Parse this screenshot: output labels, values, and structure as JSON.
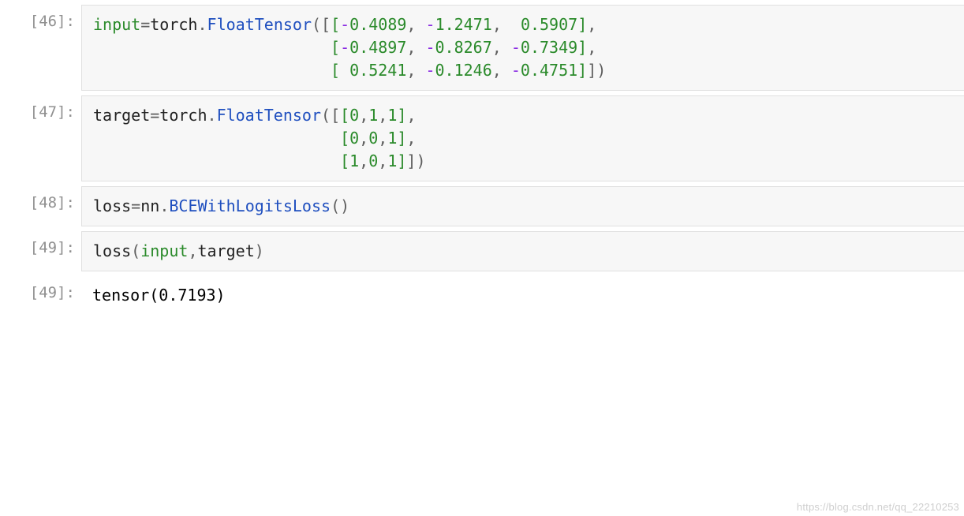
{
  "cells": [
    {
      "prompt": "[46]:",
      "kind": "code",
      "tokens": [
        [
          "builtin",
          "input"
        ],
        [
          "op",
          "="
        ],
        [
          "name",
          "torch"
        ],
        [
          "op",
          "."
        ],
        [
          "class",
          "FloatTensor"
        ],
        [
          "op",
          "("
        ],
        [
          "op",
          "["
        ],
        [
          "bracket2",
          "["
        ],
        [
          "sign",
          "-"
        ],
        [
          "num",
          "0.4089"
        ],
        [
          "op",
          ", "
        ],
        [
          "sign",
          "-"
        ],
        [
          "num",
          "1.2471"
        ],
        [
          "op",
          ",  "
        ],
        [
          "num",
          "0.5907"
        ],
        [
          "bracket2",
          "]"
        ],
        [
          "op",
          ","
        ],
        [
          "nl",
          "\n"
        ],
        [
          "sp",
          "                         "
        ],
        [
          "bracket2",
          "["
        ],
        [
          "sign",
          "-"
        ],
        [
          "num",
          "0.4897"
        ],
        [
          "op",
          ", "
        ],
        [
          "sign",
          "-"
        ],
        [
          "num",
          "0.8267"
        ],
        [
          "op",
          ", "
        ],
        [
          "sign",
          "-"
        ],
        [
          "num",
          "0.7349"
        ],
        [
          "bracket2",
          "]"
        ],
        [
          "op",
          ","
        ],
        [
          "nl",
          "\n"
        ],
        [
          "sp",
          "                         "
        ],
        [
          "bracket2",
          "[ "
        ],
        [
          "num",
          "0.5241"
        ],
        [
          "op",
          ", "
        ],
        [
          "sign",
          "-"
        ],
        [
          "num",
          "0.1246"
        ],
        [
          "op",
          ", "
        ],
        [
          "sign",
          "-"
        ],
        [
          "num",
          "0.4751"
        ],
        [
          "bracket2",
          "]"
        ],
        [
          "op",
          "]"
        ],
        [
          "op",
          ")"
        ]
      ]
    },
    {
      "prompt": "[47]:",
      "kind": "code",
      "tokens": [
        [
          "name",
          "target"
        ],
        [
          "op",
          "="
        ],
        [
          "name",
          "torch"
        ],
        [
          "op",
          "."
        ],
        [
          "class",
          "FloatTensor"
        ],
        [
          "op",
          "("
        ],
        [
          "op",
          "["
        ],
        [
          "bracket2",
          "["
        ],
        [
          "num",
          "0"
        ],
        [
          "op",
          ","
        ],
        [
          "num",
          "1"
        ],
        [
          "op",
          ","
        ],
        [
          "num",
          "1"
        ],
        [
          "bracket2",
          "]"
        ],
        [
          "op",
          ","
        ],
        [
          "nl",
          "\n"
        ],
        [
          "sp",
          "                          "
        ],
        [
          "bracket2",
          "["
        ],
        [
          "num",
          "0"
        ],
        [
          "op",
          ","
        ],
        [
          "num",
          "0"
        ],
        [
          "op",
          ","
        ],
        [
          "num",
          "1"
        ],
        [
          "bracket2",
          "]"
        ],
        [
          "op",
          ","
        ],
        [
          "nl",
          "\n"
        ],
        [
          "sp",
          "                          "
        ],
        [
          "bracket2",
          "["
        ],
        [
          "num",
          "1"
        ],
        [
          "op",
          ","
        ],
        [
          "num",
          "0"
        ],
        [
          "op",
          ","
        ],
        [
          "num",
          "1"
        ],
        [
          "bracket2",
          "]"
        ],
        [
          "op",
          "]"
        ],
        [
          "op",
          ")"
        ]
      ]
    },
    {
      "prompt": "[48]:",
      "kind": "code",
      "tokens": [
        [
          "name",
          "loss"
        ],
        [
          "op",
          "="
        ],
        [
          "name",
          "nn"
        ],
        [
          "op",
          "."
        ],
        [
          "class",
          "BCEWithLogitsLoss"
        ],
        [
          "op",
          "("
        ],
        [
          "op",
          ")"
        ]
      ]
    },
    {
      "prompt": "[49]:",
      "kind": "code",
      "tokens": [
        [
          "name",
          "loss"
        ],
        [
          "op",
          "("
        ],
        [
          "builtin",
          "input"
        ],
        [
          "op",
          ","
        ],
        [
          "name",
          "target"
        ],
        [
          "op",
          ")"
        ]
      ]
    },
    {
      "prompt": "[49]:",
      "kind": "out",
      "text": "tensor(0.7193)"
    }
  ],
  "watermark": "https://blog.csdn.net/qq_22210253"
}
